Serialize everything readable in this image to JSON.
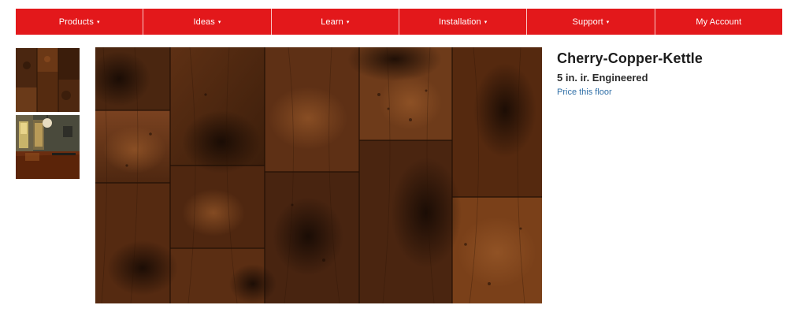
{
  "nav": {
    "items": [
      {
        "label": "Products",
        "has_dropdown": true
      },
      {
        "label": "Ideas",
        "has_dropdown": true
      },
      {
        "label": "Learn",
        "has_dropdown": true
      },
      {
        "label": "Installation",
        "has_dropdown": true
      },
      {
        "label": "Support",
        "has_dropdown": true
      },
      {
        "label": "My Account",
        "has_dropdown": false
      }
    ],
    "caret": "▾"
  },
  "product": {
    "title": "Cherry-Copper-Kettle",
    "subtitle": "5 in. ir. Engineered",
    "price_link": "Price this floor"
  },
  "colors": {
    "nav_background": "#e3181b",
    "link": "#2f6fa7",
    "wood_dark": "#3a1e0c",
    "wood_mid": "#6e3a18",
    "wood_light": "#8a4a1e"
  }
}
